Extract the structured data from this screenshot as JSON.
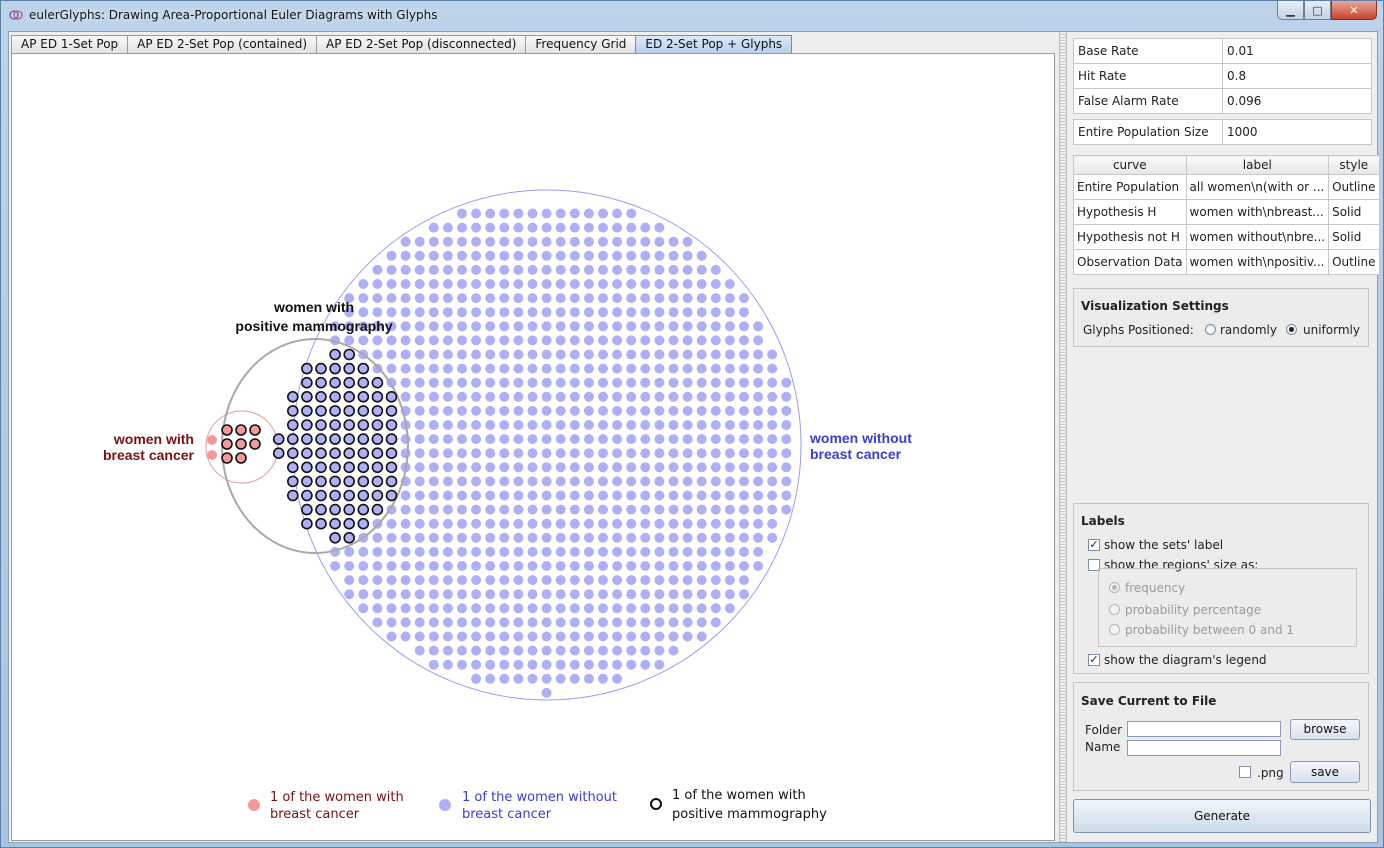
{
  "window": {
    "title": "eulerGlyphs: Drawing Area-Proportional Euler Diagrams with Glyphs",
    "min_glyph": "▁",
    "max_glyph": "□",
    "close_glyph": "✕"
  },
  "tabs": [
    {
      "label": "AP ED 1-Set Pop",
      "active": false
    },
    {
      "label": "AP ED 2-Set Pop (contained)",
      "active": false
    },
    {
      "label": "AP ED 2-Set Pop (disconnected)",
      "active": false
    },
    {
      "label": "Frequency Grid",
      "active": false
    },
    {
      "label": "ED 2-Set Pop + Glyphs",
      "active": true
    }
  ],
  "rates": [
    {
      "name": "Base Rate",
      "value": "0.01"
    },
    {
      "name": "Hit Rate",
      "value": "0.8"
    },
    {
      "name": "False Alarm Rate",
      "value": "0.096"
    }
  ],
  "population": {
    "name": "Entire Population Size",
    "value": "1000"
  },
  "curves": {
    "headers": [
      "curve",
      "label",
      "style"
    ],
    "rows": [
      [
        "Entire Population",
        "all women\\n(with or ...",
        "Outline"
      ],
      [
        "Hypothesis H",
        "women with\\nbreast...",
        "Solid"
      ],
      [
        "Hypothesis not H",
        "women without\\nbre...",
        "Solid"
      ],
      [
        "Observation Data",
        "women with\\npositiv...",
        "Outline"
      ]
    ]
  },
  "visualization": {
    "title": "Visualization Settings",
    "glyphs_label": "Glyphs Positioned:",
    "option_random": "randomly",
    "option_uniform": "uniformly",
    "selected": "uniformly"
  },
  "labels_panel": {
    "title": "Labels",
    "show_sets_label": "show the sets' label",
    "show_sets_label_checked": true,
    "show_regions_size": "show the regions' size as:",
    "show_regions_size_checked": false,
    "size_options": [
      "frequency",
      "probability percentage",
      "probability between 0 and 1"
    ],
    "size_selected": "frequency",
    "show_legend": "show the diagram's legend",
    "show_legend_checked": true
  },
  "save_panel": {
    "title": "Save Current to File",
    "folder_label": "Folder",
    "name_label": "Name",
    "folder_value": "",
    "name_value": "",
    "browse_label": "browse",
    "png_label": ".png",
    "png_checked": false,
    "save_label": "save"
  },
  "generate_label": "Generate",
  "diagram": {
    "label_positive_line1": "women with",
    "label_positive_line2": "positive mammography",
    "label_cancer_line1": "women with",
    "label_cancer_line2": "breast cancer",
    "label_nocancer_line1": "women without",
    "label_nocancer_line2": "breast cancer",
    "colors": {
      "cancer": "#f29a9a",
      "cancer_text": "#7a1010",
      "no_cancer": "#aeb0f5",
      "no_cancer_text": "#3a3ecf",
      "positive_outline": "#111111",
      "population_circle": "#9a9df0",
      "positive_ellipse": "#a8a8a8",
      "cancer_circle": "#e39a9a"
    },
    "legend": [
      {
        "line1": "1 of the women with",
        "line2": "breast cancer",
        "kind": "cancer"
      },
      {
        "line1": "1 of the women without",
        "line2": "breast cancer",
        "kind": "no-cancer"
      },
      {
        "line1": "1 of the women with",
        "line2": "positive mammography",
        "kind": "positive"
      }
    ]
  }
}
